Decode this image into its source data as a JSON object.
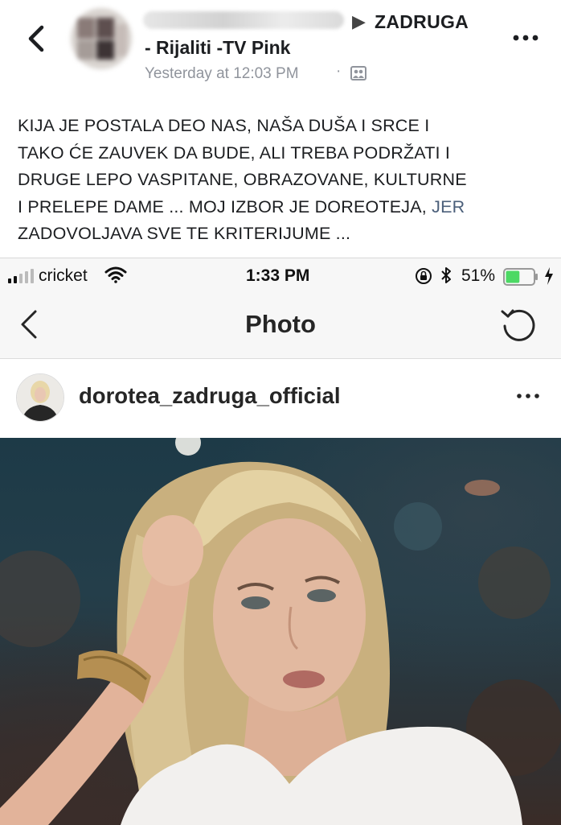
{
  "fb_post": {
    "group_name_line1": "ZADRUGA",
    "group_name_line2": "- Rijaliti -TV Pink",
    "timestamp": "Yesterday at 12:03 PM",
    "separator": "·",
    "audience_icon": "friends-audience-icon",
    "text_lines": [
      "KIJA JE POSTALA DEO NAS, NAŠA DUŠA I SRCE I",
      "TAKO ĆE ZAUVEK DA BUDE, ALI TREBA PODRŽATI I",
      "DRUGE LEPO VASPITANE, OBRAZOVANE, KULTURNE",
      "I PRELEPE DAME ... MOJ IZBOR JE DOREOTEJA, ",
      "ZADOVOLJAVA SVE TE KRITERIJUME ..."
    ],
    "text_line4_end": "JER"
  },
  "status_bar": {
    "carrier": "cricket",
    "time": "1:33 PM",
    "battery_percent_label": "51%",
    "battery_level": 0.51,
    "battery_color": "#4cd964"
  },
  "ig_nav": {
    "title": "Photo"
  },
  "ig_post": {
    "username": "dorotea_zadruga_official"
  },
  "colors": {
    "fb_text": "#1c1e21",
    "fb_meta": "#90949c",
    "ig_text": "#262626"
  }
}
